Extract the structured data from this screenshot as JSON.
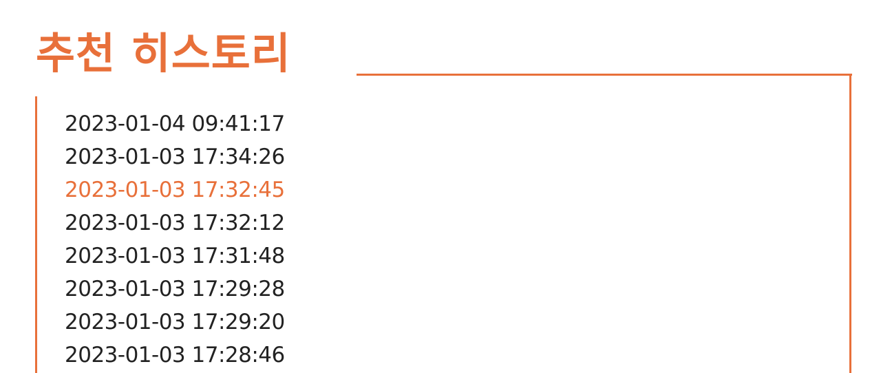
{
  "colors": {
    "accent": "#E8703A",
    "text": "#222222",
    "background": "#ffffff"
  },
  "header": {
    "title": "추천 히스토리"
  },
  "history": {
    "selected_index": 2,
    "items": [
      {
        "label": "2023-01-04 09:41:17"
      },
      {
        "label": "2023-01-03 17:34:26"
      },
      {
        "label": "2023-01-03 17:32:45"
      },
      {
        "label": "2023-01-03 17:32:12"
      },
      {
        "label": "2023-01-03 17:31:48"
      },
      {
        "label": "2023-01-03 17:29:28"
      },
      {
        "label": "2023-01-03 17:29:20"
      },
      {
        "label": "2023-01-03 17:28:46"
      }
    ]
  }
}
